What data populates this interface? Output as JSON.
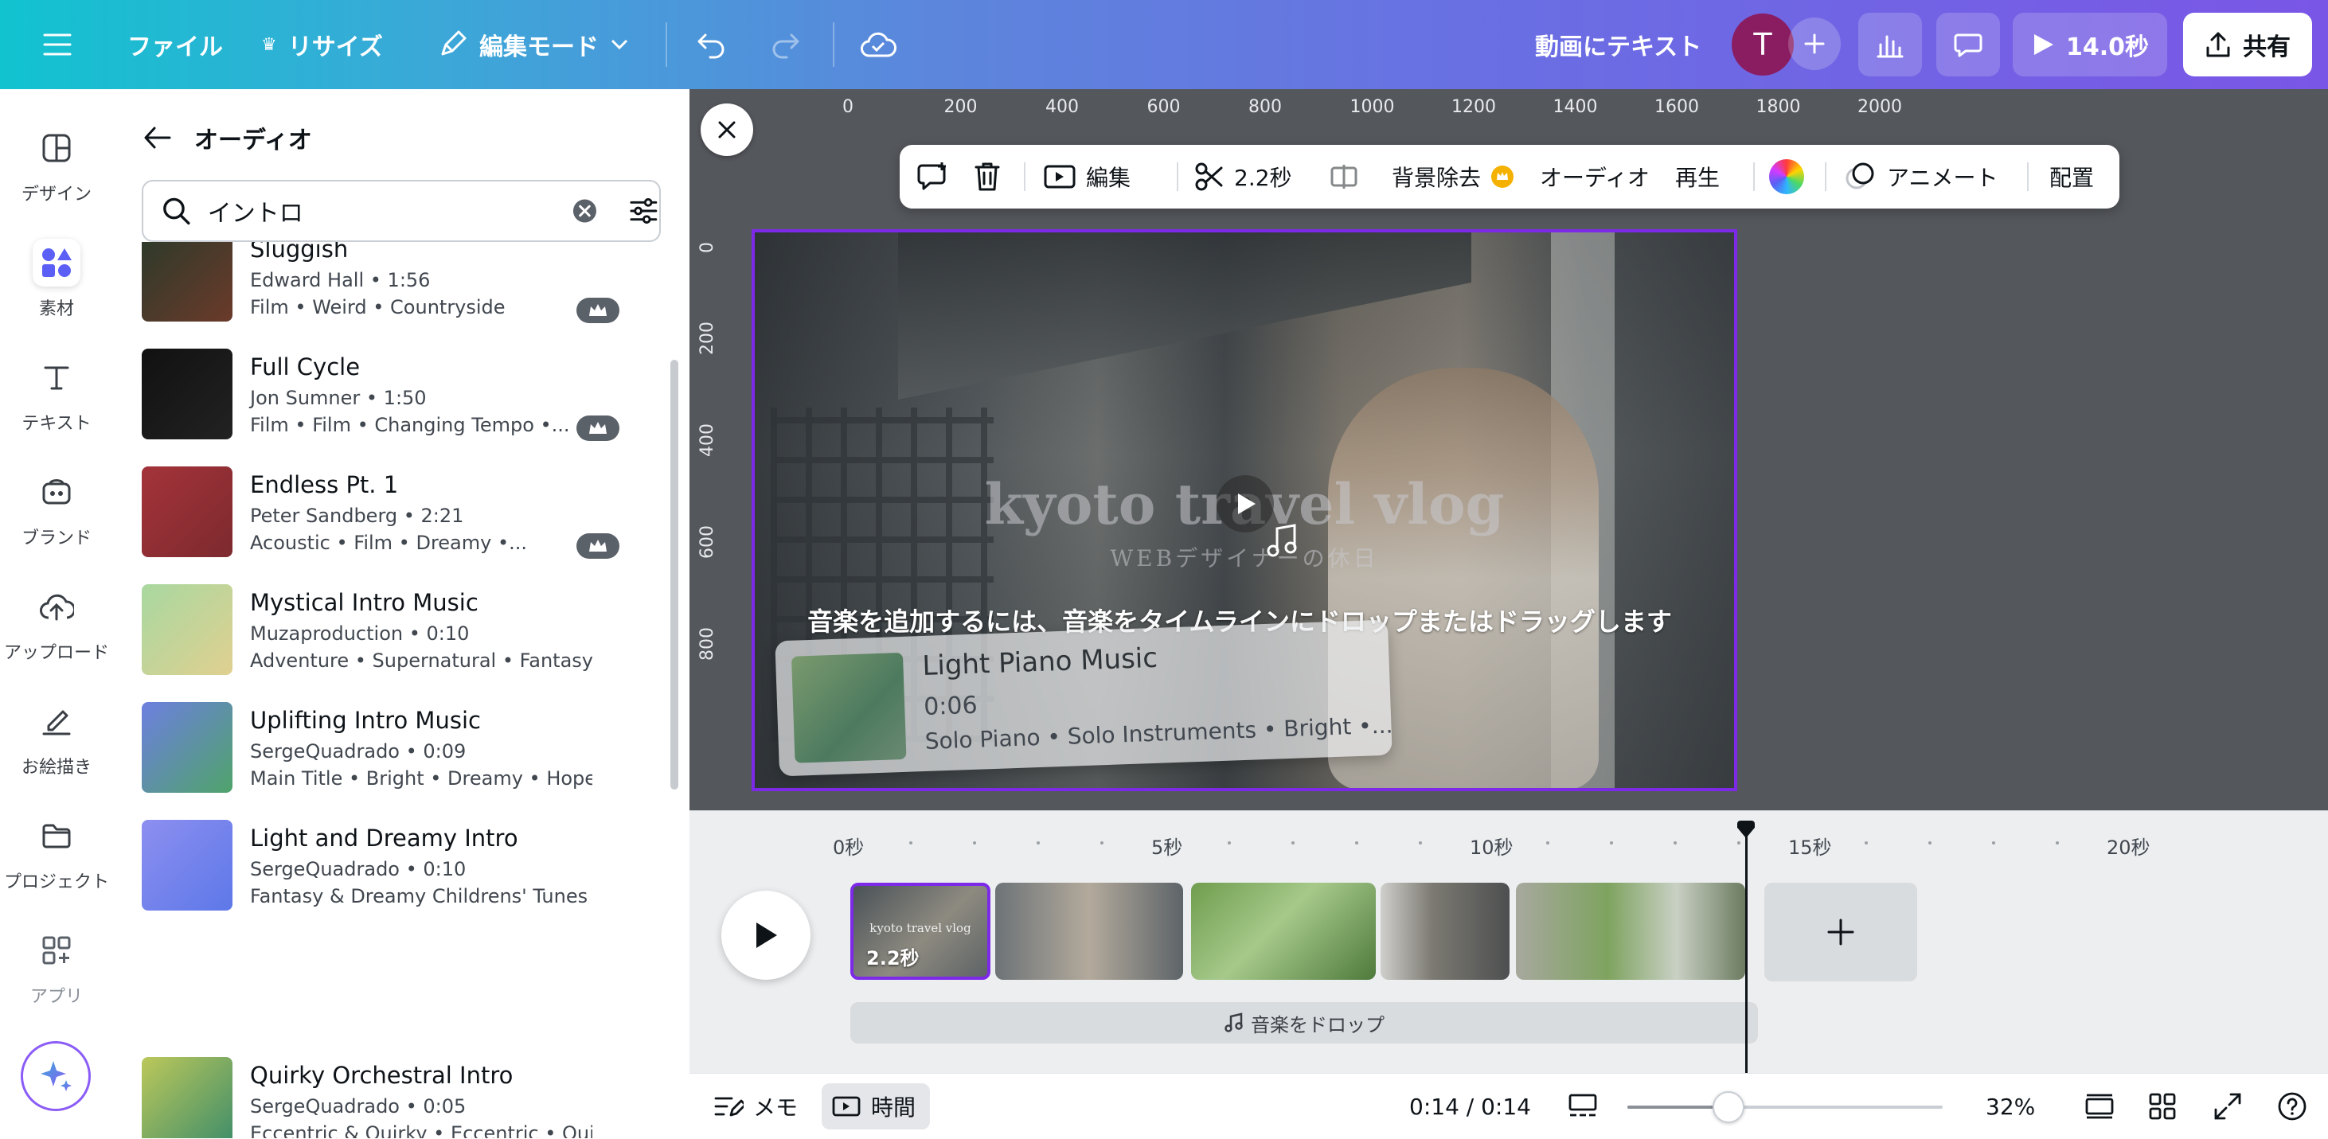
{
  "topbar": {
    "file": "ファイル",
    "resize": "リサイズ",
    "edit_mode": "編集モード",
    "text_to_video": "動画にテキスト",
    "avatar_initial": "T",
    "play_duration": "14.0秒",
    "share": "共有"
  },
  "rail": [
    {
      "label": "デザイン",
      "icon": "design-icon"
    },
    {
      "label": "素材",
      "icon": "elements-icon",
      "active": true
    },
    {
      "label": "テキスト",
      "icon": "text-icon"
    },
    {
      "label": "ブランド",
      "icon": "brand-icon"
    },
    {
      "label": "アップロード",
      "icon": "upload-icon"
    },
    {
      "label": "お絵描き",
      "icon": "draw-icon"
    },
    {
      "label": "プロジェクト",
      "icon": "folder-icon"
    },
    {
      "label": "アプリ",
      "icon": "apps-icon"
    }
  ],
  "panel": {
    "title": "オーディオ",
    "search_value": "イントロ",
    "tracks": [
      {
        "title": "Sluggish",
        "meta": "Edward Hall • 1:56",
        "tags": "Film • Weird • Countryside",
        "premium": true
      },
      {
        "title": "Full Cycle",
        "meta": "Jon Sumner • 1:50",
        "tags": "Film • Film • Changing Tempo •...",
        "premium": true
      },
      {
        "title": "Endless Pt. 1",
        "meta": "Peter Sandberg • 2:21",
        "tags": "Acoustic • Film • Dreamy •...",
        "premium": true
      },
      {
        "title": "Mystical Intro Music",
        "meta": "Muzaproduction • 0:10",
        "tags": "Adventure • Supernatural • Fantasy &...",
        "premium": false
      },
      {
        "title": "Uplifting Intro Music",
        "meta": "SergeQuadrado • 0:09",
        "tags": "Main Title • Bright • Dreamy • Hopeful ...",
        "premium": false
      },
      {
        "title": "Light and Dreamy Intro",
        "meta": "SergeQuadrado • 0:10",
        "tags": "Fantasy & Dreamy Childrens' Tunes •...",
        "premium": false
      },
      {
        "title": "Quirky Orchestral Intro",
        "meta": "SergeQuadrado • 0:05",
        "tags": "Eccentric & Quirky • Eccentric • Quirky",
        "premium": false
      }
    ],
    "thumb_colors": [
      [
        "#2b3a2a",
        "#6b3a2a"
      ],
      [
        "#111111",
        "#222222"
      ],
      [
        "#a4333a",
        "#7c2a2e"
      ],
      [
        "#a8d8a0",
        "#e0d090"
      ],
      [
        "#6d7fe0",
        "#4fa36a"
      ],
      [
        "#8d8ff0",
        "#5d78e8"
      ],
      [
        "#bcc85a",
        "#3d8c6a"
      ]
    ]
  },
  "editor": {
    "ruler_h": [
      "0",
      "200",
      "400",
      "600",
      "800",
      "1000",
      "1200",
      "1400",
      "1600",
      "1800",
      "2000"
    ],
    "ruler_v": [
      "0",
      "200",
      "400",
      "600",
      "800"
    ],
    "ctx": {
      "edit": "編集",
      "duration": "2.2秒",
      "bg_remove": "背景除去",
      "audio": "オーディオ",
      "play": "再生",
      "animate": "アニメート",
      "position": "配置"
    },
    "canvas_title": "kyoto travel vlog",
    "canvas_subtitle": "WEBデザイナーの休日",
    "drop_message": "音楽を追加するには、音楽をタイムラインにドロップまたはドラッグします",
    "drag_card": {
      "title": "Light Piano Music",
      "duration": "0:06",
      "tags": "Solo Piano • Solo Instruments • Bright •..."
    }
  },
  "timeline": {
    "ticks": [
      "0秒",
      "5秒",
      "10秒",
      "15秒",
      "20秒"
    ],
    "clip1_duration": "2.2秒",
    "clip1_title": "kyoto travel vlog",
    "audio_drop": "音楽をドロップ"
  },
  "bottombar": {
    "notes": "メモ",
    "duration": "時間",
    "timecode": "0:14 / 0:14",
    "zoom": "32%",
    "zoom_fraction": 0.32
  },
  "colors": {
    "accent": "#7d2ae8",
    "topbar_start": "#11c3cf",
    "topbar_end": "#7a56e6",
    "premium_crown": "#f5b100"
  }
}
